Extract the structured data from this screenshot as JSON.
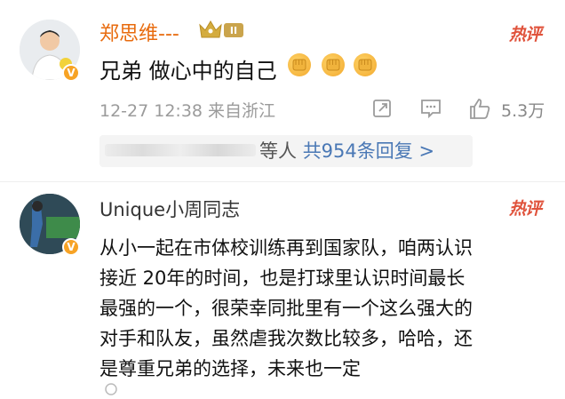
{
  "comments": [
    {
      "username": "郑思维---",
      "level": "II",
      "hot_label": "热评",
      "text": "兄弟 做心中的自己",
      "emoji_count": 3,
      "meta": "12-27 12:38 来自浙江",
      "likes": "5.3万",
      "reply_prefix": "等人",
      "reply_link": "共954条回复 >"
    },
    {
      "username": "Unique小周同志",
      "hot_label": "热评",
      "lines": [
        "从小一起在市体校训练再到国家队，咱两认识",
        "接近 20年的时间，也是打球里认识时间最长",
        "最强的一个，很荣幸同批里有一个这么强大的",
        "对手和队友，虽然虐我次数比较多，哈哈，还",
        "是尊重兄弟的选择，未来也一定"
      ]
    }
  ],
  "colors": {
    "username_vip": "#e86b0e",
    "hot": "#e0533c",
    "link": "#4a78b5",
    "meta": "#9b9b9b",
    "verified_badge": "#f7a325"
  },
  "icons": {
    "share": "share-icon",
    "comment": "comment-icon",
    "like": "thumbs-up-icon",
    "crown": "crown-icon",
    "fist": "fist-bump-emoji"
  }
}
